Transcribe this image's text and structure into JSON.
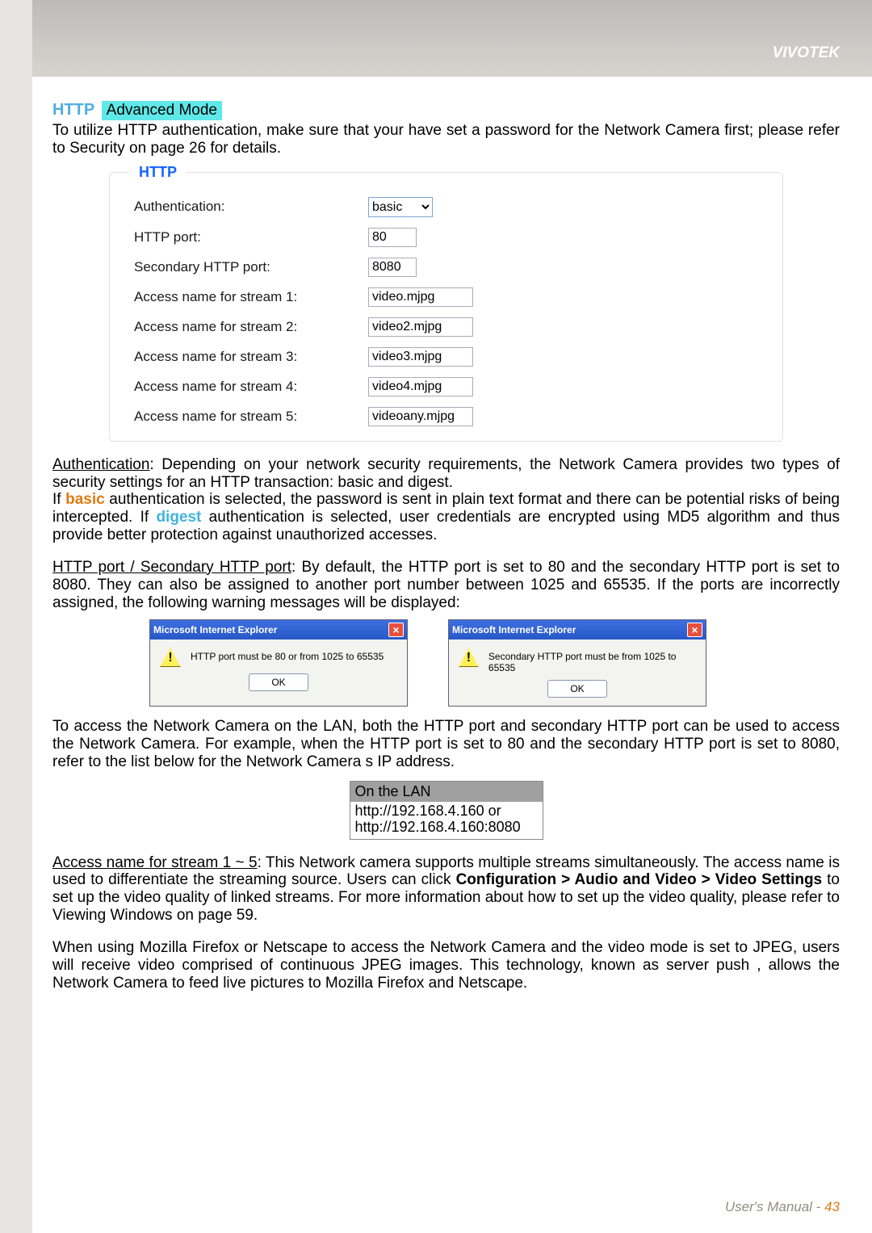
{
  "brand": "VIVOTEK",
  "section": {
    "title": "HTTP",
    "badge": "Advanced Mode"
  },
  "intro": "To utilize HTTP authentication, make sure that your have set a password for the Network Camera first; please refer to Security on page 26 for details.",
  "panel": {
    "legend": "HTTP",
    "rows": {
      "auth_label": "Authentication:",
      "auth_value": "basic",
      "port_label": "HTTP port:",
      "port_value": "80",
      "secport_label": "Secondary HTTP port:",
      "secport_value": "8080",
      "s1_label": "Access name for stream 1:",
      "s1_value": "video.mjpg",
      "s2_label": "Access name for stream 2:",
      "s2_value": "video2.mjpg",
      "s3_label": "Access name for stream 3:",
      "s3_value": "video3.mjpg",
      "s4_label": "Access name for stream 4:",
      "s4_value": "video4.mjpg",
      "s5_label": "Access name for stream 5:",
      "s5_value": "videoany.mjpg"
    }
  },
  "auth_para": {
    "lead": "Authentication",
    "rest1": ": Depending on your network security requirements, the Network Camera provides two types of security settings for an HTTP transaction: basic and digest.",
    "if": "If ",
    "basic": "basic",
    "mid1": " authentication is selected, the password is sent in plain text format and there can be potential risks of being intercepted. If ",
    "digest": "digest",
    "mid2": " authentication is selected, user credentials are encrypted using MD5 algorithm and thus provide better protection against unauthorized accesses."
  },
  "port_para": {
    "lead": "HTTP port / Secondary HTTP port",
    "rest": ": By default, the HTTP port is set to 80 and the secondary HTTP port is set to 8080. They can also be assigned to another port number between 1025 and 65535. If the ports are incorrectly assigned, the following warning messages will be displayed:"
  },
  "dialog1": {
    "title": "Microsoft Internet Explorer",
    "msg": "HTTP port must be 80 or from 1025 to 65535",
    "ok": "OK"
  },
  "dialog2": {
    "title": "Microsoft Internet Explorer",
    "msg": "Secondary HTTP port must be from 1025 to 65535",
    "ok": "OK"
  },
  "lan_para": "To access the Network Camera on the LAN, both the HTTP port and secondary HTTP port can be used to access the Network Camera. For example, when the HTTP port is set to 80 and the secondary HTTP port is set to 8080, refer to the list below for the Network Camera s IP address.",
  "lan_box": {
    "head": "On the LAN",
    "line1": "http://192.168.4.160  or",
    "line2": "http://192.168.4.160:8080"
  },
  "access_para": {
    "lead": "Access name for stream 1 ~ 5",
    "rest1": ": This Network camera supports multiple streams simultaneously. The access name is used to differentiate the streaming source. Users can click ",
    "bold": "Configuration > Audio and Video > Video Settings",
    "rest2": " to set up the video quality of linked streams. For more information about how to set up the video quality, please refer to Viewing Windows on page 59."
  },
  "moz_para": "When using Mozilla Firefox or Netscape to access the Network Camera and the video mode is set to JPEG, users will receive video comprised of continuous JPEG images. This technology, known as  server push , allows the Network Camera to feed live pictures to Mozilla Firefox and Netscape.",
  "footer": {
    "label": "User's Manual - ",
    "page": "43"
  }
}
